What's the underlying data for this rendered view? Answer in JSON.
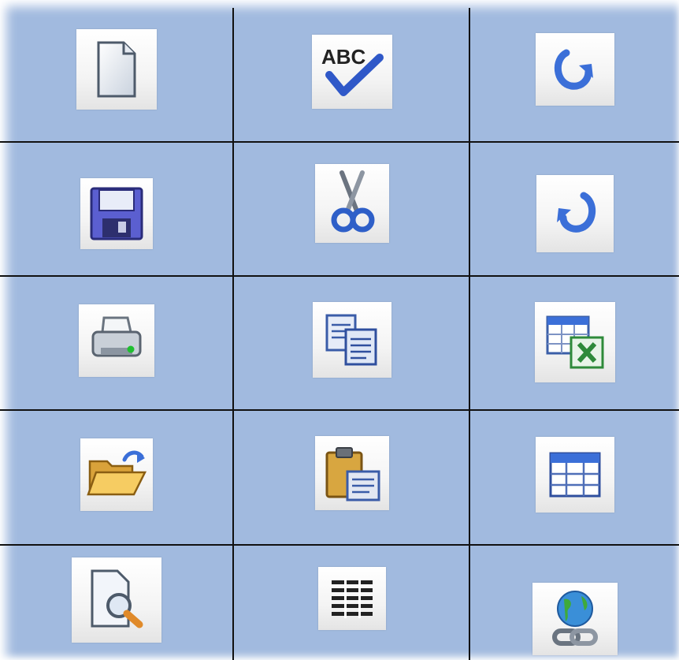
{
  "grid": {
    "rows": 5,
    "columns": 3,
    "background_color": "#a1badf",
    "line_color": "#111111"
  },
  "icons": [
    {
      "row": 1,
      "column": 1,
      "icon": "new-document-icon"
    },
    {
      "row": 1,
      "column": 2,
      "icon": "spell-check-icon",
      "text": "ABC"
    },
    {
      "row": 1,
      "column": 3,
      "icon": "redo-icon"
    },
    {
      "row": 2,
      "column": 1,
      "icon": "save-floppy-icon"
    },
    {
      "row": 2,
      "column": 2,
      "icon": "cut-scissors-icon"
    },
    {
      "row": 2,
      "column": 3,
      "icon": "undo-icon"
    },
    {
      "row": 3,
      "column": 1,
      "icon": "print-icon"
    },
    {
      "row": 3,
      "column": 2,
      "icon": "copy-icon"
    },
    {
      "row": 3,
      "column": 3,
      "icon": "export-excel-icon"
    },
    {
      "row": 4,
      "column": 1,
      "icon": "open-folder-icon"
    },
    {
      "row": 4,
      "column": 2,
      "icon": "paste-icon"
    },
    {
      "row": 4,
      "column": 3,
      "icon": "table-icon"
    },
    {
      "row": 5,
      "column": 1,
      "icon": "print-preview-icon"
    },
    {
      "row": 5,
      "column": 2,
      "icon": "list-view-icon"
    },
    {
      "row": 5,
      "column": 3,
      "icon": "web-link-icon"
    }
  ]
}
